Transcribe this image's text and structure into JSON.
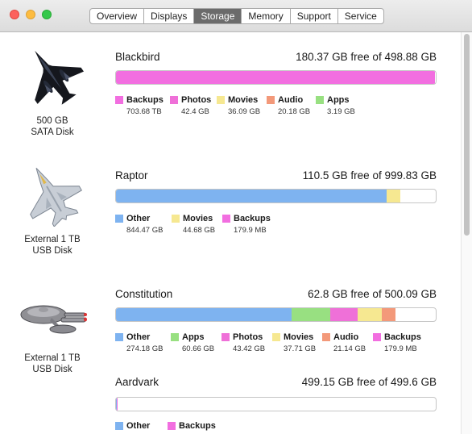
{
  "tabs": [
    {
      "label": "Overview",
      "active": false
    },
    {
      "label": "Displays",
      "active": false
    },
    {
      "label": "Storage",
      "active": true
    },
    {
      "label": "Memory",
      "active": false
    },
    {
      "label": "Support",
      "active": false
    },
    {
      "label": "Service",
      "active": false
    }
  ],
  "colors": {
    "Backups": "#f26ee0",
    "Photos": "#ef70d8",
    "Movies": "#f6e891",
    "Audio": "#f3997a",
    "Apps": "#98e081",
    "Other": "#7eb3f0"
  },
  "disks": [
    {
      "name": "Blackbird",
      "free_text": "180.37 GB free of 498.88 GB",
      "caption": [
        "500 GB",
        "SATA Disk"
      ],
      "icon": "sr71-blackbird-icon",
      "segments": [
        {
          "category": "Backups",
          "fraction": 0.997
        }
      ],
      "legend": [
        {
          "label": "Backups",
          "size": "703.68 TB"
        },
        {
          "label": "Photos",
          "size": "42.4 GB"
        },
        {
          "label": "Movies",
          "size": "36.09 GB"
        },
        {
          "label": "Audio",
          "size": "20.18 GB"
        },
        {
          "label": "Apps",
          "size": "3.19 GB"
        }
      ]
    },
    {
      "name": "Raptor",
      "free_text": "110.5 GB free of 999.83 GB",
      "caption": [
        "External 1 TB",
        "USB Disk"
      ],
      "icon": "f22-raptor-icon",
      "segments": [
        {
          "category": "Other",
          "fraction": 0.846
        },
        {
          "category": "Movies",
          "fraction": 0.044
        }
      ],
      "legend": [
        {
          "label": "Other",
          "size": "844.47 GB"
        },
        {
          "label": "Movies",
          "size": "44.68 GB"
        },
        {
          "label": "Backups",
          "size": "179.9 MB"
        }
      ]
    },
    {
      "name": "Constitution",
      "free_text": "62.8 GB free of 500.09 GB",
      "caption": [
        "External 1 TB",
        "USB Disk"
      ],
      "icon": "starship-enterprise-icon",
      "segments": [
        {
          "category": "Other",
          "fraction": 0.548
        },
        {
          "category": "Apps",
          "fraction": 0.121
        },
        {
          "category": "Photos",
          "fraction": 0.087
        },
        {
          "category": "Movies",
          "fraction": 0.075
        },
        {
          "category": "Audio",
          "fraction": 0.042
        }
      ],
      "legend": [
        {
          "label": "Other",
          "size": "274.18 GB"
        },
        {
          "label": "Apps",
          "size": "60.66 GB"
        },
        {
          "label": "Photos",
          "size": "43.42 GB"
        },
        {
          "label": "Movies",
          "size": "37.71 GB"
        },
        {
          "label": "Audio",
          "size": "21.14 GB"
        },
        {
          "label": "Backups",
          "size": "179.9 MB"
        }
      ]
    },
    {
      "name": "Aardvark",
      "free_text": "499.15 GB free of 499.6 GB",
      "caption": [],
      "icon": "",
      "segments": [
        {
          "category": "Other",
          "fraction": 0.001
        },
        {
          "category": "Backups",
          "fraction": 0.001
        }
      ],
      "legend": [
        {
          "label": "Other",
          "size": ""
        },
        {
          "label": "Backups",
          "size": ""
        }
      ]
    }
  ]
}
